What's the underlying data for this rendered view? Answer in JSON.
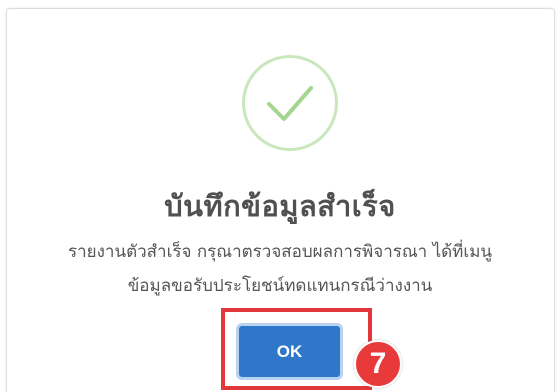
{
  "dialog": {
    "title": "บันทึกข้อมูลสำเร็จ",
    "message_line1": "รายงานตัวสำเร็จ กรุณาตรวจสอบผลการพิจารณา ได้ที่เมนู",
    "message_line2": "ข้อมูลขอรับประโยชน์ทดแทนกรณีว่างงาน",
    "ok_label": "OK",
    "icon": "check-icon"
  },
  "annotation": {
    "step_number": "7",
    "highlight_color": "#e2383b"
  },
  "colors": {
    "button": "#2f77c9",
    "success_ring": "#c9e7bd",
    "check": "#a5d68f"
  }
}
